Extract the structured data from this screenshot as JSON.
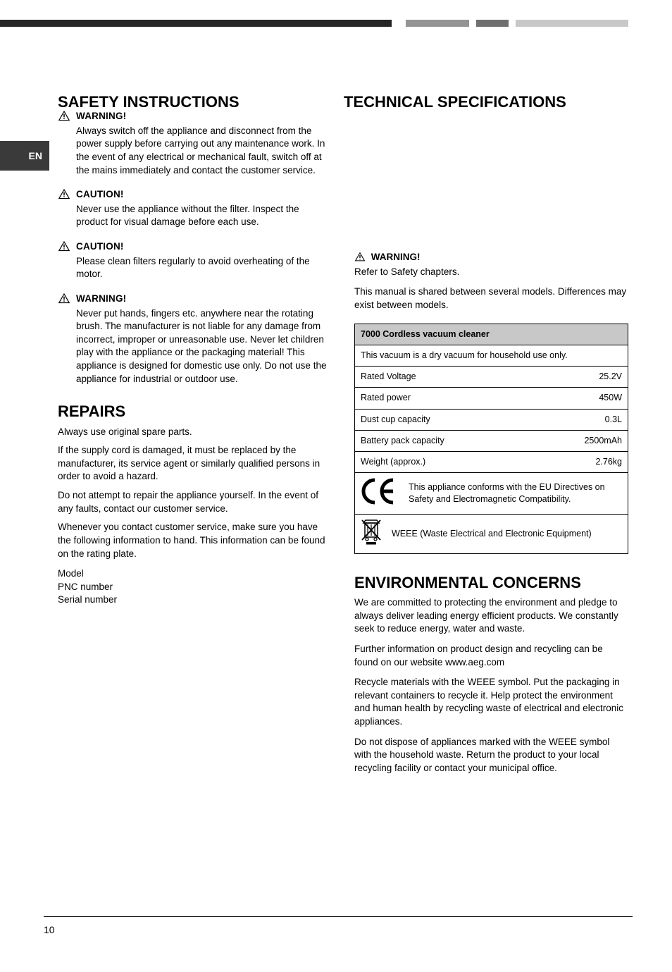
{
  "page": {
    "tab": "EN",
    "number": "10"
  },
  "left": {
    "section_title": "SAFETY INSTRUCTIONS",
    "w1": {
      "label": "WARNING!",
      "body": "Always switch off the appliance and disconnect from the power supply before carrying out any maintenance work. In the event of any electrical or mechanical fault, switch off at the mains immediately and contact the customer service."
    },
    "w2": {
      "label": "CAUTION!",
      "body": "Never use the appliance without the filter.  Inspect the product for visual damage before each use."
    },
    "w3": {
      "label": "CAUTION!",
      "body": "Please clean filters regularly to avoid overheating of the motor."
    },
    "w4": {
      "label": "WARNING!",
      "body": "Never put hands, fingers etc. anywhere near the rotating brush. The manufacturer is not liable for any damage from incorrect, improper or unreasonable use. Never let children play with the appliance or the packaging material! This appliance is designed for domestic use only. Do not use the appliance for industrial or outdoor use."
    },
    "h2_repairs": "REPAIRS",
    "p1": "Always use original spare parts.",
    "p2": "If the supply cord is damaged, it must be replaced by the manufacturer, its service agent or similarly qualified persons in order to avoid a hazard.",
    "p3": "Do not attempt to repair the appliance yourself. In the event of any faults, contact our customer service.",
    "p4": "Whenever you contact customer service, make sure you have the following information to hand. This information can be found on the rating plate.",
    "info_list": [
      "Model",
      "PNC number",
      "Serial number"
    ]
  },
  "right": {
    "section_title": "TECHNICAL SPECIFICATIONS",
    "intro_warn_label": "WARNING!",
    "intro_warn_body": "Refer to Safety chapters.",
    "p1": "This manual is shared between several models. Differences may exist between models.",
    "spec_header": "7000 Cordless vacuum cleaner",
    "rows": [
      {
        "l": "This vacuum is a dry vacuum for household use only.",
        "v": ""
      },
      {
        "l": "Rated Voltage",
        "v": "25.2V"
      },
      {
        "l": "Rated power",
        "v": "450W"
      },
      {
        "l": "Dust cup capacity",
        "v": "0.3L"
      },
      {
        "l": "Battery pack capacity",
        "v": "2500mAh"
      },
      {
        "l": "Weight (approx.)",
        "v": "2.76kg"
      }
    ],
    "ce_text": "This appliance conforms with the EU Directives on Safety and Electromagnetic Compatibility.",
    "weee_text": "WEEE (Waste Electrical and Electronic Equipment)",
    "h2_env": "ENVIRONMENTAL CONCERNS",
    "env_p1": "We are committed to protecting the environment and pledge to always deliver leading energy efficient products. We constantly seek to reduce energy, water and waste.",
    "env_p2": "Further information on product design and recycling can be found on our website www.aeg.com",
    "env_p3": "Recycle materials with the WEEE symbol. Put the packaging in relevant containers to recycle it. Help protect the environment and human health by recycling waste of electrical and electronic appliances.",
    "env_p4": "Do not dispose of appliances marked with the WEEE symbol with the household waste. Return the product to your local recycling facility or contact your municipal office."
  }
}
